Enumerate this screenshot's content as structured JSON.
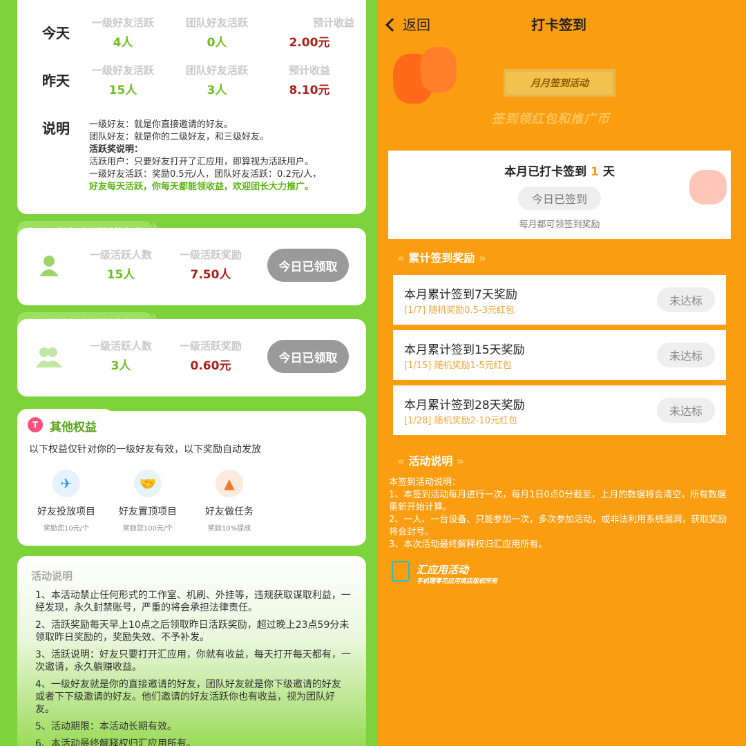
{
  "left": {
    "stats": {
      "today_label": "今天",
      "yesterday_label": "昨天",
      "col_headers": [
        "一级好友活跃",
        "团队好友活跃",
        "预计收益"
      ],
      "today": [
        "4人",
        "0人",
        "2.00元"
      ],
      "yesterday": [
        "15人",
        "3人",
        "8.10元"
      ],
      "desc_label": "说明",
      "desc_lines": [
        "一级好友：就是你直接邀请的好友。",
        "团队好友：就是你的二级好友，和三级好友。",
        "活跃奖说明：",
        "活跃用户：只要好友打开了汇应用，即算视为活跃用户。",
        "一级好友活跃：奖励0.5元/人，团队好友活跃：0.2元/人，",
        "好友每天活跃，你每天都能领收益，欢迎团长大力推广。"
      ]
    },
    "level1_reward": {
      "section_title": "昨日一级好友活跃奖领取",
      "count_label": "一级活跃人数",
      "count_value": "15人",
      "reward_label": "一级活跃奖励",
      "reward_value": "7.50人",
      "button": "今日已领取"
    },
    "team_reward": {
      "section_title": "昨日团队好友活跃奖领取",
      "count_label": "一级活跃人数",
      "count_value": "3人",
      "reward_label": "一级活跃奖励",
      "reward_value": "0.60元",
      "button": "今日已领取"
    },
    "other": {
      "icon_letter": "T",
      "title": "其他权益",
      "subtitle": "以下权益仅针对你的一级好友有效，以下奖励自动发放",
      "perks": [
        {
          "label": "好友投放项目",
          "sub": "奖励您10元/个",
          "icon": "paper-plane-icon"
        },
        {
          "label": "好友置顶项目",
          "sub": "奖励您100元/个",
          "icon": "handshake-icon"
        },
        {
          "label": "好友做任务",
          "sub": "奖励10%提成",
          "icon": "stamp-icon"
        }
      ]
    },
    "rules": {
      "title": "活动说明",
      "items": [
        "1、本活动禁止任何形式的工作室、机刷、外挂等，违规获取谋取利益，一经发现，永久封禁账号，严重的将会承担法律责任。",
        "2、活跃奖励每天早上10点之后领取昨日活跃奖励，超过晚上23点59分未领取昨日奖励的，奖励失效、不予补发。",
        "3、活跃说明：好友只要打开汇应用，你就有收益，每天打开每天都有，一次邀请，永久躺赚收益。",
        "4、一级好友就是你的直接邀请的好友，团队好友就是你下级邀请的好友 或者下下级邀请的好友。他们邀请的好友活跃你也有收益，视为团队好友。",
        "5、活动期限：本活动长期有效。",
        "6、本活动最终解释权归汇应用所有。"
      ]
    }
  },
  "right": {
    "back_label": "返回",
    "title": "打卡签到",
    "banner": "月月签到活动",
    "slogan": "签到领红包和推广币",
    "checkin": {
      "title_prefix": "本月已打卡签到",
      "days": "1",
      "title_suffix": "天",
      "button": "今日已签到",
      "sub": "每月都可领签到奖励"
    },
    "accum_title": "累计签到奖励",
    "tasks": [
      {
        "title": "本月累计签到7天奖励",
        "sub": "[1/7] 随机奖励0.5-3元红包",
        "button": "未达标"
      },
      {
        "title": "本月累计签到15天奖励",
        "sub": "[1/15] 随机奖励1-5元红包",
        "button": "未达标"
      },
      {
        "title": "本月累计签到28天奖励",
        "sub": "[1/28] 随机奖励2-10元红包",
        "button": "未达标"
      }
    ],
    "rules_title": "活动说明",
    "rules": [
      "本签到活动说明：",
      "1、本签到活动每月进行一次，每月1日0点0分截至，上月的数据将会清空，所有数据重新开始计算。",
      "2、一人、一台设备、只能参加一次，多次参加活动，或非法利用系统漏洞，获取奖励将会封号。",
      "3、本次活动最终解释权归汇应用所有。"
    ],
    "footer_title": "汇应用活动",
    "footer_sub": "手机理零花应用商店版权所有"
  }
}
